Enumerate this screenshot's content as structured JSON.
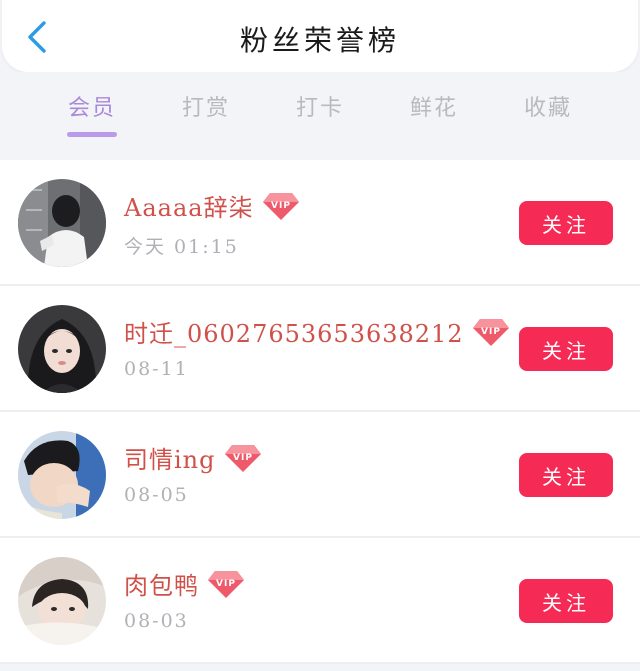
{
  "header": {
    "title": "粉丝荣誉榜",
    "back_icon": "chevron-left-icon",
    "accent_color": "#2b9be8"
  },
  "tabs": [
    {
      "label": "会员",
      "active": true
    },
    {
      "label": "打赏",
      "active": false
    },
    {
      "label": "打卡",
      "active": false
    },
    {
      "label": "鲜花",
      "active": false
    },
    {
      "label": "收藏",
      "active": false
    }
  ],
  "members": [
    {
      "name": "Aaaaa辞柒",
      "time": "今天 01:15",
      "badge": "VIP",
      "button": "关注"
    },
    {
      "name": "时迁_0602765365363821​2",
      "time": "08-11",
      "badge": "VIP",
      "button": "关注"
    },
    {
      "name": "司情ing",
      "time": "08-05",
      "badge": "VIP",
      "button": "关注"
    },
    {
      "name": "肉包鸭",
      "time": "08-03",
      "badge": "VIP",
      "button": "关注"
    }
  ],
  "colors": {
    "tab_active": "#a98ad9",
    "tab_inactive": "#b9b9bf",
    "follow_button": "#f52a55",
    "username": "#d0504a",
    "vip_badge": "#ee5a6a"
  }
}
